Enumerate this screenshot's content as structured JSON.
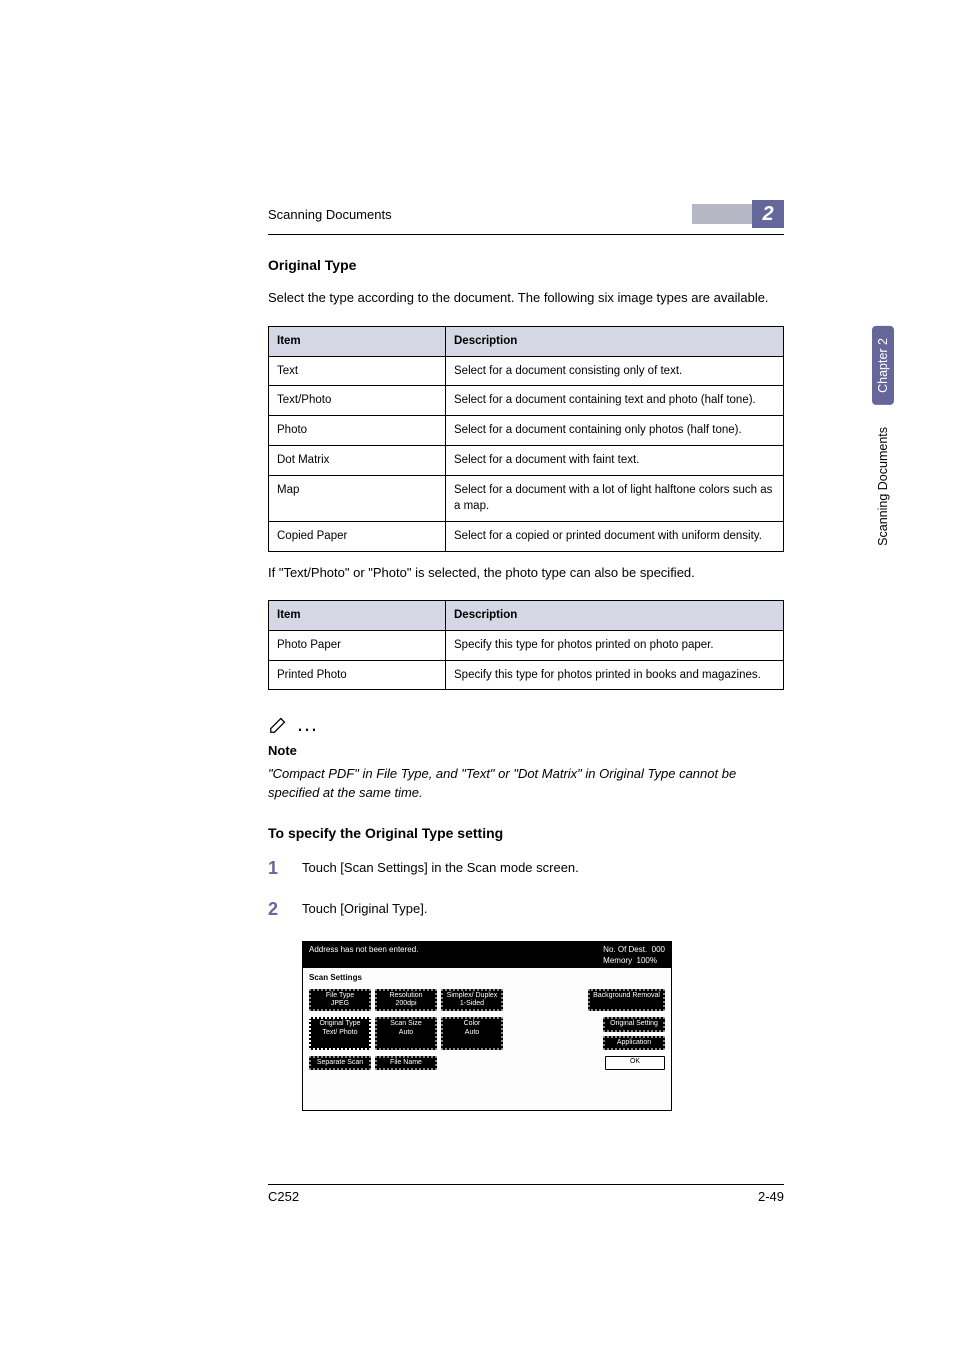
{
  "running_header": {
    "left": "Scanning Documents",
    "chapter_number": "2"
  },
  "side_tabs": {
    "dark": "Chapter 2",
    "plain": "Scanning Documents"
  },
  "section": {
    "title": "Original Type",
    "intro": "Select the type according to the document. The following six image types are available."
  },
  "table1": {
    "head_item": "Item",
    "head_desc": "Description",
    "rows": [
      {
        "item": "Text",
        "desc": "Select for a document consisting only of text."
      },
      {
        "item": "Text/Photo",
        "desc": "Select for a document containing text and photo (half tone)."
      },
      {
        "item": "Photo",
        "desc": "Select for a document containing only photos (half tone)."
      },
      {
        "item": "Dot Matrix",
        "desc": "Select for a document with faint text."
      },
      {
        "item": "Map",
        "desc": "Select for a document with a lot of light halftone colors such as a map."
      },
      {
        "item": "Copied Paper",
        "desc": "Select for a copied or printed document with uniform density."
      }
    ]
  },
  "between_tables": "If \"Text/Photo\" or \"Photo\" is selected, the photo type can also be specified.",
  "table2": {
    "head_item": "Item",
    "head_desc": "Description",
    "rows": [
      {
        "item": "Photo Paper",
        "desc": "Specify this type for photos printed on photo paper."
      },
      {
        "item": "Printed Photo",
        "desc": "Specify this type for photos printed in books and magazines."
      }
    ]
  },
  "note": {
    "label": "Note",
    "text": "\"Compact PDF\" in File Type, and \"Text\" or \"Dot Matrix\" in Original Type cannot be specified at the same time."
  },
  "procedure": {
    "heading": "To specify the Original Type setting",
    "steps": [
      "Touch [Scan Settings] in the Scan mode screen.",
      "Touch [Original Type]."
    ]
  },
  "screenshot": {
    "top_left": "Address has not been entered.",
    "no_of_dest_label": "No. Of Dest.",
    "no_of_dest_value": "000",
    "memory_label": "Memory",
    "memory_value": "100%",
    "title": "Scan Settings",
    "row1": [
      "File Type",
      "Resolution",
      "Simplex/ Duplex"
    ],
    "row1b": [
      "JPEG",
      "200dpi",
      "1-Sided"
    ],
    "row1_right": "Background Removal",
    "row2": [
      "Original Type",
      "Scan Size",
      "Color"
    ],
    "row2b": [
      "Text/ Photo",
      "Auto",
      "Auto"
    ],
    "row2_right": "Original Setting",
    "row2_right2": "Application",
    "row3": [
      "Separate Scan",
      "File Name"
    ],
    "ok": "OK"
  },
  "footer": {
    "left": "C252",
    "right": "2-49"
  }
}
